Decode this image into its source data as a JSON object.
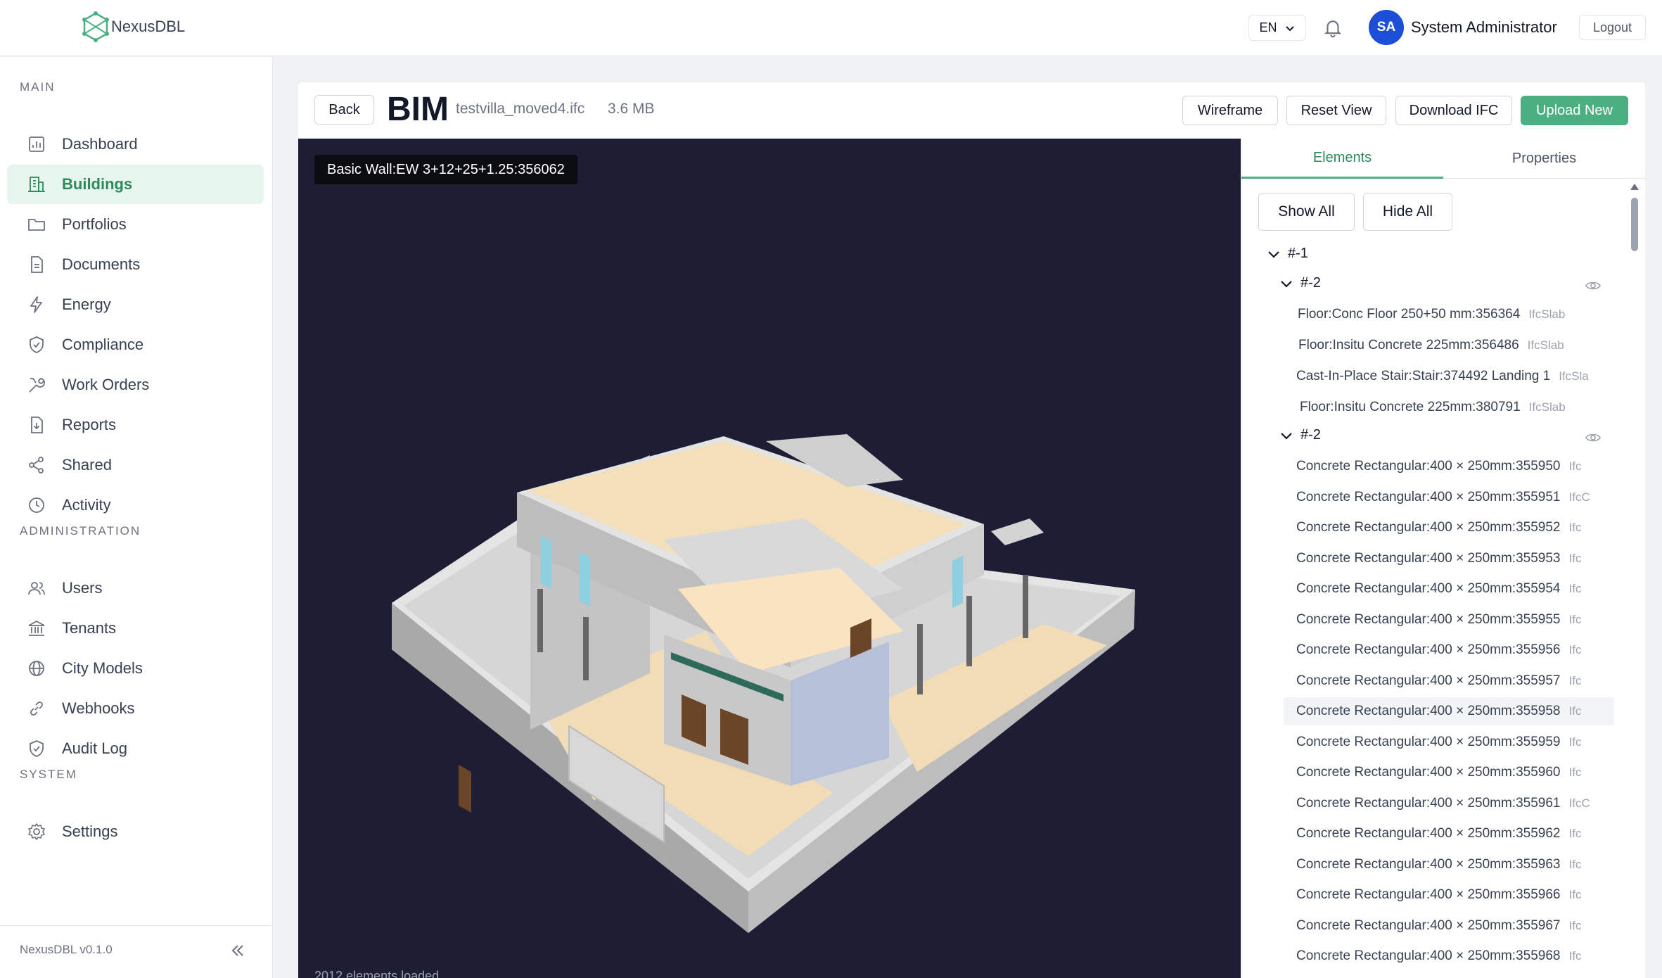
{
  "topbar": {
    "logo_text": "NexusDBL",
    "language": "EN",
    "avatar_initials": "SA",
    "user_name": "System Administrator",
    "logout_label": "Logout"
  },
  "sidebar": {
    "main_label": "MAIN",
    "main_items": [
      {
        "label": "Dashboard",
        "icon": "chart-icon"
      },
      {
        "label": "Buildings",
        "icon": "building-icon",
        "active": true
      },
      {
        "label": "Portfolios",
        "icon": "folder-icon"
      },
      {
        "label": "Documents",
        "icon": "document-icon"
      },
      {
        "label": "Energy",
        "icon": "bolt-icon"
      },
      {
        "label": "Compliance",
        "icon": "shield-check-icon"
      },
      {
        "label": "Work Orders",
        "icon": "wrench-icon"
      },
      {
        "label": "Reports",
        "icon": "report-icon"
      },
      {
        "label": "Shared",
        "icon": "share-icon"
      },
      {
        "label": "Activity",
        "icon": "clock-icon"
      }
    ],
    "admin_label": "ADMINISTRATION",
    "admin_items": [
      {
        "label": "Users",
        "icon": "users-icon"
      },
      {
        "label": "Tenants",
        "icon": "bank-icon"
      },
      {
        "label": "City Models",
        "icon": "globe-icon"
      },
      {
        "label": "Webhooks",
        "icon": "link-icon"
      },
      {
        "label": "Audit Log",
        "icon": "shield-icon"
      }
    ],
    "system_label": "SYSTEM",
    "system_items": [
      {
        "label": "Settings",
        "icon": "gear-icon"
      }
    ],
    "version": "NexusDBL v0.1.0"
  },
  "header": {
    "back_label": "Back",
    "title": "BIM",
    "filename": "testvilla_moved4.ifc",
    "filesize": "3.6 MB",
    "wireframe_label": "Wireframe",
    "reset_view_label": "Reset View",
    "download_label": "Download IFC",
    "upload_label": "Upload New"
  },
  "viewer": {
    "hover_tooltip": "Basic Wall:EW 3+12+25+1.25:356062",
    "elements_loaded": "2012 elements loaded"
  },
  "panel": {
    "tabs": [
      "Elements",
      "Properties"
    ],
    "show_all_label": "Show All",
    "hide_all_label": "Hide All",
    "root_node": "#-1",
    "group1_label": "#-2",
    "group1_items": [
      {
        "name": "Floor:Conc Floor 250+50 mm:356364",
        "type": "IfcSlab"
      },
      {
        "name": "Floor:Insitu Concrete 225mm:356486",
        "type": "IfcSlab"
      },
      {
        "name": "Cast-In-Place Stair:Stair:374492 Landing 1",
        "type": "IfcSla"
      },
      {
        "name": "Floor:Insitu Concrete 225mm:380791",
        "type": "IfcSlab"
      }
    ],
    "group2_label": "#-2",
    "group2_items": [
      {
        "name": "Concrete Rectangular:400 × 250mm:355950",
        "type": "Ifc"
      },
      {
        "name": "Concrete Rectangular:400 × 250mm:355951",
        "type": "IfcC"
      },
      {
        "name": "Concrete Rectangular:400 × 250mm:355952",
        "type": "Ifc"
      },
      {
        "name": "Concrete Rectangular:400 × 250mm:355953",
        "type": "Ifc"
      },
      {
        "name": "Concrete Rectangular:400 × 250mm:355954",
        "type": "Ifc"
      },
      {
        "name": "Concrete Rectangular:400 × 250mm:355955",
        "type": "Ifc"
      },
      {
        "name": "Concrete Rectangular:400 × 250mm:355956",
        "type": "Ifc"
      },
      {
        "name": "Concrete Rectangular:400 × 250mm:355957",
        "type": "Ifc"
      },
      {
        "name": "Concrete Rectangular:400 × 250mm:355958",
        "type": "Ifc"
      },
      {
        "name": "Concrete Rectangular:400 × 250mm:355959",
        "type": "Ifc"
      },
      {
        "name": "Concrete Rectangular:400 × 250mm:355960",
        "type": "Ifc"
      },
      {
        "name": "Concrete Rectangular:400 × 250mm:355961",
        "type": "IfcC"
      },
      {
        "name": "Concrete Rectangular:400 × 250mm:355962",
        "type": "Ifc"
      },
      {
        "name": "Concrete Rectangular:400 × 250mm:355963",
        "type": "Ifc"
      },
      {
        "name": "Concrete Rectangular:400 × 250mm:355966",
        "type": "Ifc"
      },
      {
        "name": "Concrete Rectangular:400 × 250mm:355967",
        "type": "Ifc"
      },
      {
        "name": "Concrete Rectangular:400 × 250mm:355968",
        "type": "Ifc"
      }
    ]
  },
  "colors": {
    "accent": "#4caf82",
    "accent_light": "#e6f5ee",
    "viewport_bg": "#1d1d33",
    "avatar": "#1d4ed8"
  }
}
